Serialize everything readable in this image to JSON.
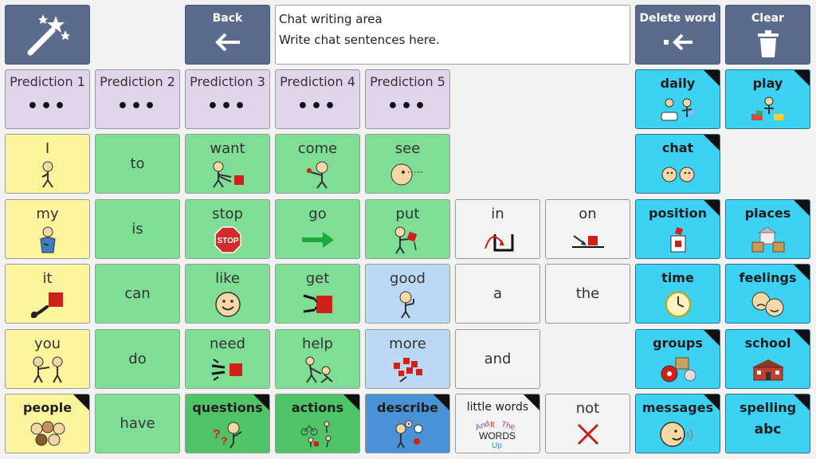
{
  "toolbar": {
    "back_label": "Back",
    "delete_label": "Delete word",
    "clear_label": "Clear"
  },
  "chat_area": {
    "title": "Chat writing area",
    "hint": "Write chat sentences here."
  },
  "predictions": [
    "Prediction 1",
    "Prediction 2",
    "Prediction 3",
    "Prediction 4",
    "Prediction 5"
  ],
  "prediction_placeholder": "•••",
  "words": {
    "i": "I",
    "to": "to",
    "want": "want",
    "come": "come",
    "see": "see",
    "my": "my",
    "is": "is",
    "stop": "stop",
    "go": "go",
    "put": "put",
    "in": "in",
    "on": "on",
    "it": "it",
    "can": "can",
    "like": "like",
    "get": "get",
    "good": "good",
    "a": "a",
    "the": "the",
    "you": "you",
    "do": "do",
    "need": "need",
    "help": "help",
    "more": "more",
    "and": "and",
    "people": "people",
    "have": "have",
    "questions": "questions",
    "actions": "actions",
    "describe": "describe",
    "little_words": "little words",
    "not": "not"
  },
  "stop_sign_text": "STOP",
  "little_words_art": {
    "and": "And",
    "it": "It",
    "the": "The",
    "words": "WORDS",
    "up": "Up"
  },
  "categories": {
    "daily": "daily",
    "play": "play",
    "chat": "chat",
    "position": "position",
    "places": "places",
    "time": "time",
    "feelings": "feelings",
    "groups": "groups",
    "school": "school",
    "messages": "messages",
    "spelling": "spelling",
    "spelling_symbol": "abc"
  },
  "colors": {
    "core_word": "#7ede96",
    "pronoun": "#fdf59e",
    "category": "#3dd2f4",
    "prediction": "#e0d4ec",
    "describing": "#bcd8f2",
    "small_word": "#f3f3f3",
    "toolbar": "#5b6b8b",
    "folder_green": "#4fc366",
    "folder_blue": "#4a92d6"
  }
}
